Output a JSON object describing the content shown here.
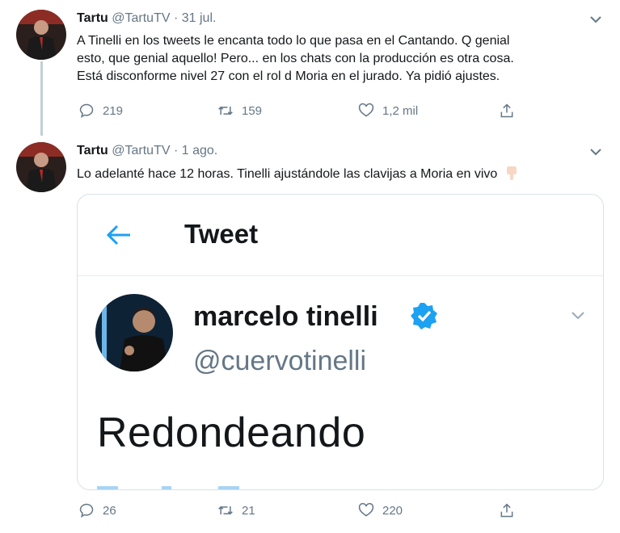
{
  "tweets": [
    {
      "name": "Tartu",
      "handle": "@TartuTV",
      "date": "· 31 jul.",
      "lines": [
        "A Tinelli en los tweets le encanta todo lo que pasa en el Cantando. Q genial",
        "esto, que genial aquello! Pero... en los chats con la producción es otra cosa.",
        "Está disconforme nivel 27 con el rol d Moria en el jurado. Ya pidió ajustes."
      ],
      "replies": "219",
      "retweets": "159",
      "likes": "1,2 mil"
    },
    {
      "name": "Tartu",
      "handle": "@TartuTV",
      "date": "· 1 ago.",
      "text": "Lo adelanté hace 12 horas. Tinelli ajustándole las clavijas a Moria en vivo",
      "emoji": "pointing-down-hand-icon",
      "replies": "26",
      "retweets": "21",
      "likes": "220"
    }
  ],
  "embedded": {
    "header_title": "Tweet",
    "name": "marcelo tinelli",
    "handle": "@cuervotinelli",
    "text": "Redondeando"
  },
  "colors": {
    "accent": "#1da1f2",
    "muted": "#657786",
    "text": "#14171a",
    "border": "#d9e1e7"
  }
}
